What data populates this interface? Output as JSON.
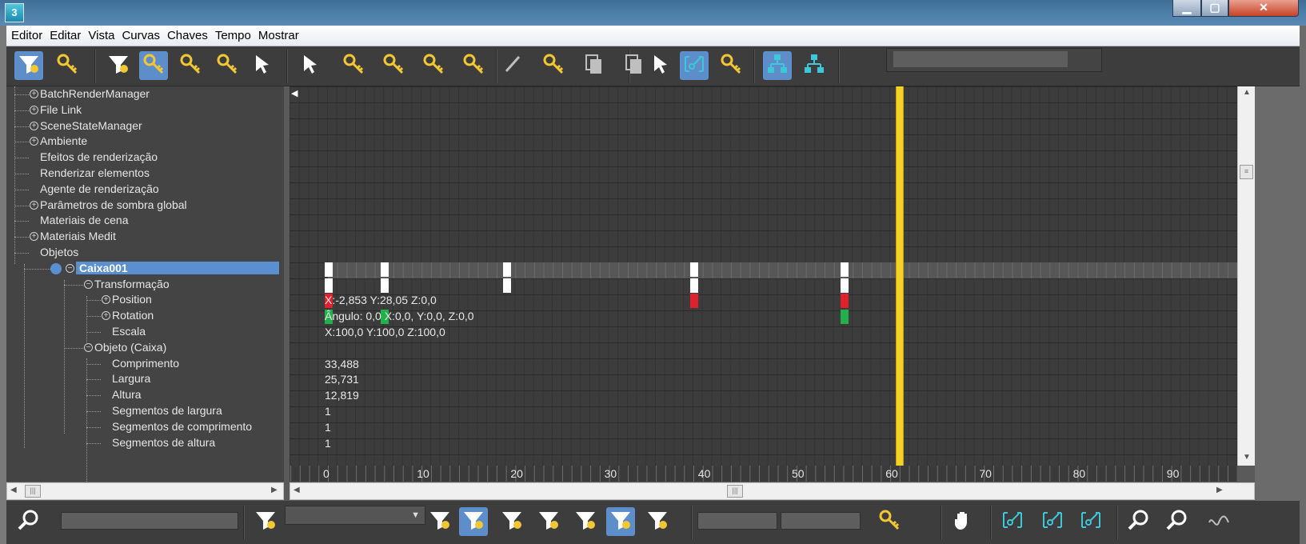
{
  "window": {
    "app_icon": "3",
    "min_label": "▁",
    "max_label": "▢",
    "close_label": "✕"
  },
  "menu": [
    "Editor",
    "Editar",
    "Vista",
    "Curvas",
    "Chaves",
    "Tempo",
    "Mostrar"
  ],
  "toolbar": {
    "icons": [
      "filter-keys-icon",
      "scale-keys-icon",
      "filter-icon",
      "move-keys-icon",
      "slide-keys-icon",
      "add-key-icon",
      "region-select-icon",
      "select-icon",
      "delete-keys-icon",
      "previous-key-icon",
      "copy-keys-icon",
      "paste-keys-icon",
      "draw-curve-icon",
      "reduce-keys-icon",
      "copy-track-icon",
      "paste-track-icon",
      "lock-selection-icon",
      "snap-frames-icon",
      "show-keyable-icon",
      "hierarchy-icon",
      "tree-icon"
    ],
    "active": [
      "filter-keys-icon",
      "move-keys-icon",
      "snap-frames-icon",
      "hierarchy-icon"
    ]
  },
  "tree": [
    {
      "label": "BatchRenderManager",
      "level": 0,
      "expandable": true
    },
    {
      "label": "File Link",
      "level": 0,
      "expandable": true
    },
    {
      "label": "SceneStateManager",
      "level": 0,
      "expandable": true
    },
    {
      "label": "Ambiente",
      "level": 0,
      "expandable": true
    },
    {
      "label": "Efeitos de renderização",
      "level": 0,
      "expandable": false
    },
    {
      "label": "Renderizar elementos",
      "level": 0,
      "expandable": false
    },
    {
      "label": "Agente de renderização",
      "level": 0,
      "expandable": false
    },
    {
      "label": "Parâmetros de sombra global",
      "level": 0,
      "expandable": true
    },
    {
      "label": "Materiais de cena",
      "level": 0,
      "expandable": false
    },
    {
      "label": "Materiais Medit",
      "level": 0,
      "expandable": true
    },
    {
      "label": "Objetos",
      "level": 0,
      "expandable": false
    },
    {
      "label": "Caixa001",
      "level": 1,
      "expandable": true,
      "selected": true
    },
    {
      "label": "Transformação",
      "level": 2,
      "expandable": true
    },
    {
      "label": "Position",
      "level": 3,
      "expandable": true
    },
    {
      "label": "Rotation",
      "level": 3,
      "expandable": true
    },
    {
      "label": "Escala",
      "level": 3,
      "expandable": false
    },
    {
      "label": "Objeto (Caixa)",
      "level": 2,
      "expandable": true
    },
    {
      "label": "Comprimento",
      "level": 3,
      "expandable": false
    },
    {
      "label": "Largura",
      "level": 3,
      "expandable": false
    },
    {
      "label": "Altura",
      "level": 3,
      "expandable": false
    },
    {
      "label": "Segmentos de largura",
      "level": 3,
      "expandable": false
    },
    {
      "label": "Segmentos de comprimento",
      "level": 3,
      "expandable": false
    },
    {
      "label": "Segmentos de altura",
      "level": 3,
      "expandable": false
    }
  ],
  "dopesheet": {
    "frames_visible": [
      0,
      99
    ],
    "current_frame": 61,
    "key_frames": [
      0,
      6,
      19,
      39,
      55
    ],
    "position_keys": [
      0,
      39,
      55
    ],
    "rotation_keys": [
      0,
      6,
      55
    ],
    "texts": {
      "position": "X:-2,853 Y:28,05 Z:0,0",
      "rotation": "Ângulo: 0,0 X:0,0, Y:0,0, Z:0,0",
      "scale": "X:100,0 Y:100,0 Z:100,0",
      "comprimento": "33,488",
      "largura": "25,731",
      "altura": "12,819",
      "seg_largura": "1",
      "seg_comprimento": "1",
      "seg_altura": "1"
    },
    "ruler_labels": [
      "0",
      "10",
      "20",
      "30",
      "40",
      "50",
      "60",
      "70",
      "80",
      "90"
    ]
  },
  "bottombar": {
    "icons": [
      "zoom-selected-icon",
      "filter-edit-icon",
      "filter-icon",
      "filter-active-icon",
      "filter-film-icon",
      "filter-layers-icon",
      "filter-visible-icon",
      "filter-keyable-icon",
      "filter-lock-icon",
      "key-stats-icon",
      "pan-icon",
      "frame-horizontal-icon",
      "frame-values-icon",
      "frame-range-icon",
      "zoom-icon",
      "zoom-region-icon",
      "isolate-curve-icon"
    ],
    "active": [
      "filter-active-icon",
      "filter-keyable-icon"
    ]
  }
}
